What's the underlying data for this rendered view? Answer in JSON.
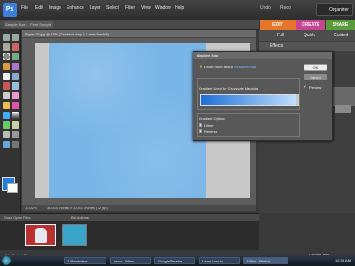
{
  "menubar": {
    "logo_text": "Ps",
    "items": [
      "File",
      "Edit",
      "Image",
      "Enhance",
      "Layer",
      "Select",
      "Filter",
      "View",
      "Window",
      "Help"
    ],
    "undo": "Undo",
    "redo": "Redo",
    "organizer": "Organizer"
  },
  "options_bar": {
    "sample_size": "Sample Size:",
    "point_sample": "Point Sample"
  },
  "mode_tabs": {
    "edit": "EDIT",
    "create": "CREATE",
    "share": "SHARE"
  },
  "panel_buttons": {
    "full": "Full",
    "quick": "Quick",
    "guided": "Guided"
  },
  "effects_panel": {
    "title": "Effects"
  },
  "document": {
    "title": "Paper-15.jpg @ 13% (Gradient Map 1, Layer Mask/8)",
    "zoom": "13.02%",
    "info": "30.014 inches x 30.014 inches (72 ppi)"
  },
  "dialog": {
    "title": "Gradient Map",
    "learn_prefix": "Learn more about:",
    "learn_link": "Gradient Map",
    "ok": "OK",
    "cancel": "Cancel",
    "preview": "Preview",
    "preview_checked": true,
    "gradient_section": "Gradient Used for Grayscale Mapping",
    "gradient_colors": [
      "#1e6fd6",
      "#bfdfff"
    ],
    "options_section": "Gradient Options",
    "dither": "Dither",
    "reverse": "Reverse"
  },
  "project_bin": {
    "show_open_files": "Show Open Files",
    "bin_actions": "Bin Actions",
    "hide_project_bin": "Hide Project Bin",
    "delete_bin": "Delete Bin"
  },
  "colors": {
    "foreground": "#1f7fdb",
    "background": "#ffffff",
    "edit_tab": "#e6762a",
    "create_tab": "#c8468f",
    "share_tab": "#5a9c37"
  },
  "taskbar": {
    "tasks": [
      "2 Reminders",
      "Inbox - Micro...",
      "Google Reader...",
      "Learn how to ...",
      "Editor - Photos..."
    ],
    "clock": "12:38 AM"
  }
}
